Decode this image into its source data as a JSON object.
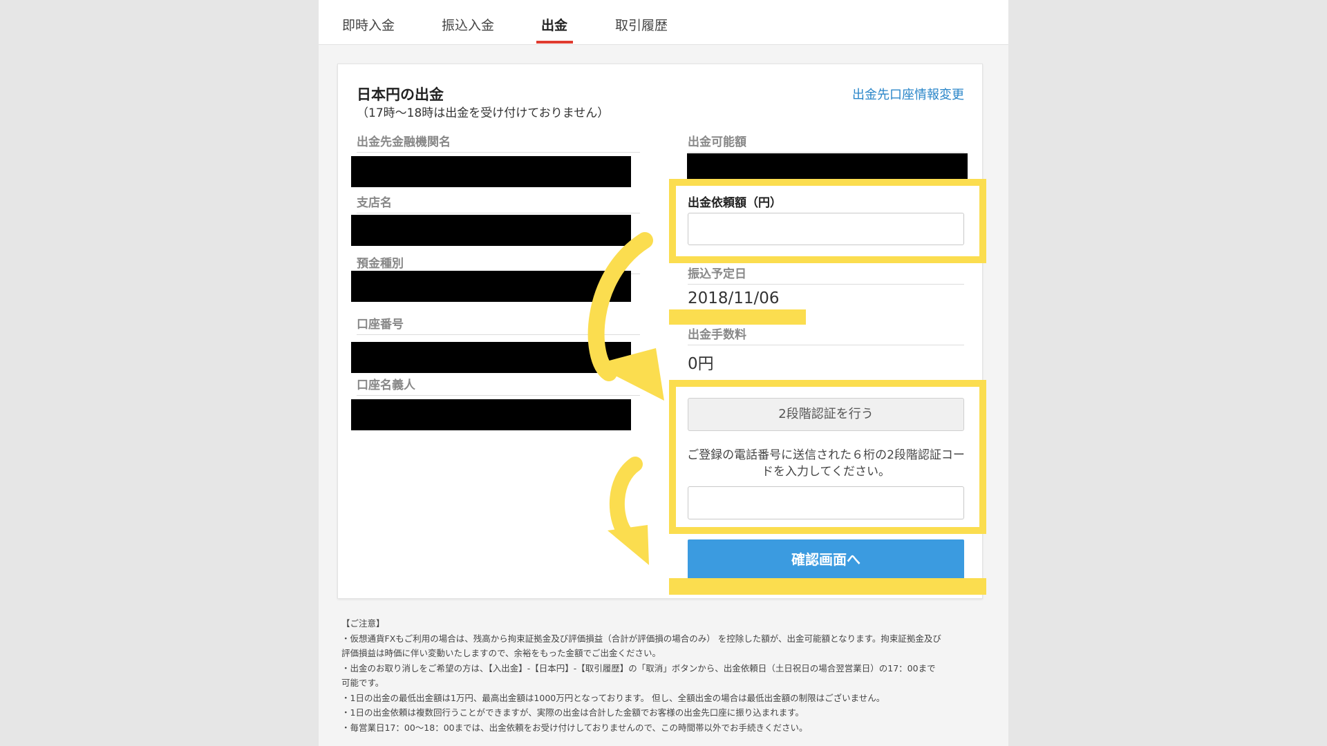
{
  "tabs": [
    {
      "label": "即時入金",
      "active": false
    },
    {
      "label": "振込入金",
      "active": false
    },
    {
      "label": "出金",
      "active": true
    },
    {
      "label": "取引履歴",
      "active": false
    }
  ],
  "card": {
    "title": "日本円の出金",
    "note": "（17時～18時は出金を受け付けておりません）",
    "change_link": "出金先口座情報変更"
  },
  "left_fields": {
    "bank_name": "出金先金融機関名",
    "branch": "支店名",
    "account_type": "預金種別",
    "account_number": "口座番号",
    "account_holder": "口座名義人"
  },
  "right_fields": {
    "available": "出金可能額",
    "request_amount": "出金依頼額（円）",
    "scheduled_date_label": "振込予定日",
    "scheduled_date": "2018/11/06",
    "fee_label": "出金手数料",
    "fee": "0円"
  },
  "twofa": {
    "button": "2段階認証を行う",
    "help": "ご登録の電話番号に送信された６桁の2段階認証コードを入力してください。"
  },
  "confirm_button": "確認画面へ",
  "notes": {
    "heading": "【ご注意】",
    "lines": [
      "・仮想通貨FXもご利用の場合は、残高から拘束証拠金及び評価損益（合計が評価損の場合のみ） を控除した額が、出金可能額となります。拘束証拠金及び",
      "評価損益は時価に伴い変動いたしますので、余裕をもった金額でご出金ください。",
      "・出金のお取り消しをご希望の方は、【入出金】-【日本円】-【取引履歴】の「取消」ボタンから、出金依頼日（土日祝日の場合翌営業日）の17：00まで",
      "可能です。",
      "・1日の出金の最低出金額は1万円、最高出金額は1000万円となっております。 但し、全額出金の場合は最低出金額の制限はございません。",
      "・1日の出金依頼は複数回行うことができますが、実際の出金は合計した金額でお客様の出金先口座に振り込まれます。",
      "・毎営業日17：00～18：00までは、出金依頼をお受け付けしておりませんので、この時間帯以外でお手続きください。"
    ]
  },
  "colors": {
    "highlight": "#fbdd4f",
    "tab_active_underline": "#e03b2f",
    "confirm_button": "#3b9be0",
    "link": "#2a86c9"
  },
  "icons": {
    "arrows": [
      "curved-arrow-icon",
      "curved-arrow-icon"
    ]
  }
}
